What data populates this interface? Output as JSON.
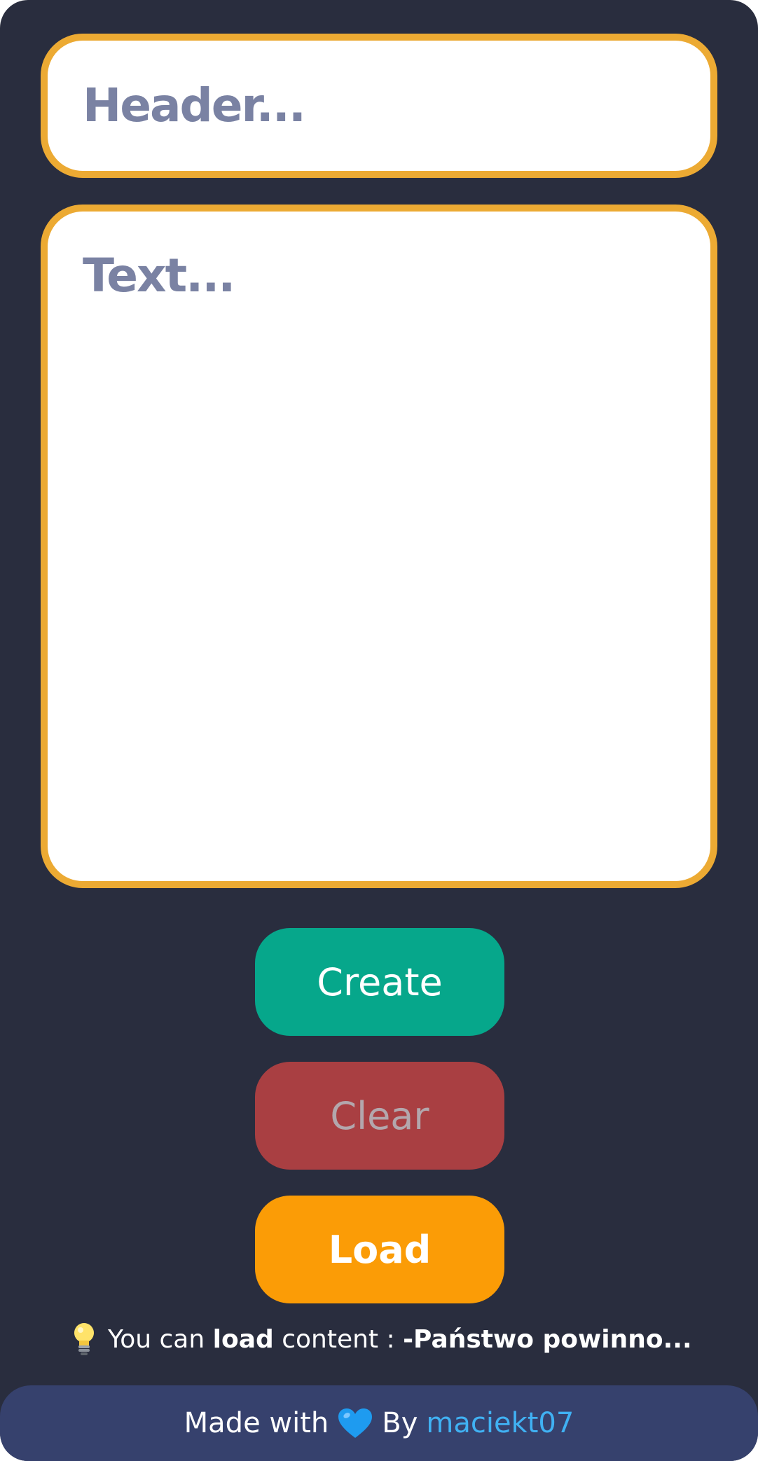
{
  "header_field": {
    "placeholder": "Header...",
    "value": ""
  },
  "text_field": {
    "placeholder": "Text...",
    "value": ""
  },
  "buttons": {
    "create": "Create",
    "clear": "Clear",
    "load": "Load"
  },
  "hint": {
    "icon": "lightbulb-icon",
    "prefix": "You can",
    "emphasis": "load",
    "middle": "content :",
    "preview": "-Państwo powinno..."
  },
  "footer": {
    "made_with": "Made with",
    "heart_icon": "blue-heart-icon",
    "by": "By",
    "author": "maciekt07"
  },
  "colors": {
    "background": "#292d3e",
    "field_border": "#ecaa33",
    "placeholder": "#7a82a3",
    "create": "#06a78b",
    "clear": "#a93f42",
    "load": "#fb9c06",
    "footer": "#36416d",
    "link": "#40b1f3"
  }
}
